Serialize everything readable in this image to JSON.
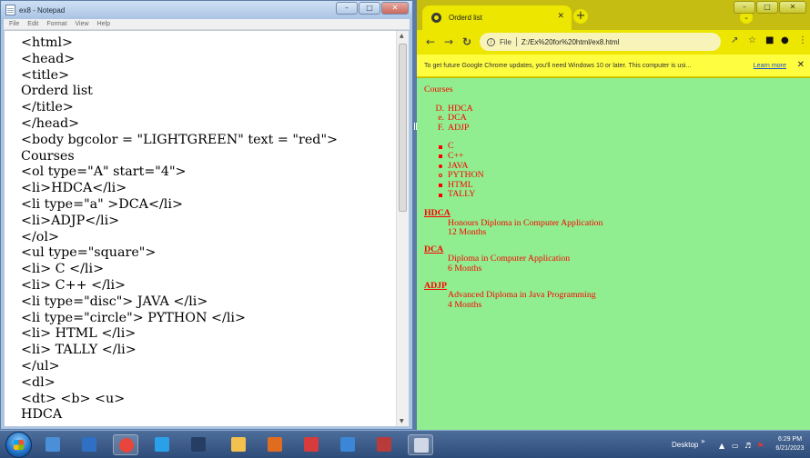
{
  "notepad": {
    "title": "ex8 - Notepad",
    "menu": [
      "File",
      "Edit",
      "Format",
      "View",
      "Help"
    ],
    "lines": [
      "<html>",
      "<head>",
      "<title>",
      "Orderd list",
      "</title>",
      "</head>",
      "<body bgcolor = \"LIGHTGREEN\" text = \"red\">",
      "Courses",
      "<ol type=\"A\" start=\"4\">",
      "<li>HDCA</li>",
      "<li type=\"a\" >DCA</li>",
      "<li>ADJP</li>",
      "</ol>",
      "<ul type=\"square\">",
      "<li> C </li>",
      "<li> C++ </li>",
      "<li type=\"disc\"> JAVA </li>",
      "<li type=\"circle\"> PYTHON </li>",
      "<li> HTML </li>",
      "<li> TALLY </li>",
      "</ul>",
      "<dl>",
      "<dt> <b> <u>",
      "HDCA"
    ]
  },
  "chrome": {
    "tab_title": "Orderd list",
    "omnibox_label": "File",
    "url": "Z:/Ex%20for%20html/ex8.html",
    "infobar_message": "To get future Google Chrome updates, you'll need Windows 10 or later. This computer is usi...",
    "learn_more": "Learn more",
    "page": {
      "bgcolor": "#90ee90",
      "text_color": "#ff0000",
      "heading": "Courses",
      "ordered_list": [
        {
          "marker": "D.",
          "text": "HDCA"
        },
        {
          "marker": "e.",
          "text": "DCA"
        },
        {
          "marker": "F.",
          "text": "ADJP"
        }
      ],
      "unordered_list": [
        {
          "bullet": "square",
          "text": "C"
        },
        {
          "bullet": "square",
          "text": "C++"
        },
        {
          "bullet": "disc",
          "text": "JAVA"
        },
        {
          "bullet": "circle",
          "text": "PYTHON"
        },
        {
          "bullet": "square",
          "text": "HTML"
        },
        {
          "bullet": "square",
          "text": "TALLY"
        }
      ],
      "definitions": [
        {
          "term": "HDCA",
          "desc": [
            "Honours Diploma in Computer Application",
            "12 Months"
          ]
        },
        {
          "term": "DCA",
          "desc": [
            "Diploma in Computer Application",
            "6 Months"
          ]
        },
        {
          "term": "ADJP",
          "desc": [
            "Advanced Diploma in Java Programming",
            "4 Months"
          ]
        }
      ]
    }
  },
  "taskbar": {
    "desktop_label": "Desktop",
    "time": "6:29 PM",
    "date": "6/21/2023",
    "apps": [
      {
        "name": "control-panel",
        "color": "#4a8fd8"
      },
      {
        "name": "outlook",
        "color": "#2f6fc4"
      },
      {
        "name": "chrome",
        "color": "#e8453c"
      },
      {
        "name": "edge",
        "color": "#2aa0e8"
      },
      {
        "name": "terminal",
        "color": "#263e63"
      },
      {
        "name": "explorer",
        "color": "#f2c14e"
      },
      {
        "name": "office",
        "color": "#e06c1f"
      },
      {
        "name": "paint",
        "color": "#d73b3b"
      },
      {
        "name": "photos",
        "color": "#3b86d6"
      },
      {
        "name": "tool",
        "color": "#b83a3a"
      },
      {
        "name": "notepad",
        "color": "#cfd8e4"
      }
    ]
  }
}
